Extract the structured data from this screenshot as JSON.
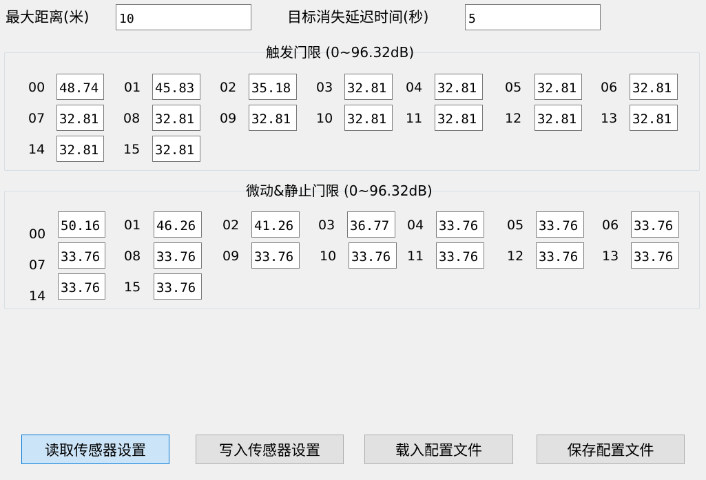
{
  "settings": {
    "max_distance_label": "最大距离(米)",
    "max_distance_value": "10",
    "delay_label": "目标消失延迟时间(秒)",
    "delay_value": "5"
  },
  "trigger_group": {
    "title": "触发门限 (0~96.32dB)",
    "gates": [
      {
        "label": "00",
        "value": "48.74"
      },
      {
        "label": "01",
        "value": "45.83"
      },
      {
        "label": "02",
        "value": "35.18"
      },
      {
        "label": "03",
        "value": "32.81"
      },
      {
        "label": "04",
        "value": "32.81"
      },
      {
        "label": "05",
        "value": "32.81"
      },
      {
        "label": "06",
        "value": "32.81"
      },
      {
        "label": "07",
        "value": "32.81"
      },
      {
        "label": "08",
        "value": "32.81"
      },
      {
        "label": "09",
        "value": "32.81"
      },
      {
        "label": "10",
        "value": "32.81"
      },
      {
        "label": "11",
        "value": "32.81"
      },
      {
        "label": "12",
        "value": "32.81"
      },
      {
        "label": "13",
        "value": "32.81"
      },
      {
        "label": "14",
        "value": "32.81"
      },
      {
        "label": "15",
        "value": "32.81"
      }
    ]
  },
  "static_group": {
    "title": "微动&静止门限 (0~96.32dB)",
    "gates": [
      {
        "label": "00",
        "value": "50.16"
      },
      {
        "label": "01",
        "value": "46.26"
      },
      {
        "label": "02",
        "value": "41.26"
      },
      {
        "label": "03",
        "value": "36.77"
      },
      {
        "label": "04",
        "value": "33.76"
      },
      {
        "label": "05",
        "value": "33.76"
      },
      {
        "label": "06",
        "value": "33.76"
      },
      {
        "label": "07",
        "value": "33.76"
      },
      {
        "label": "08",
        "value": "33.76"
      },
      {
        "label": "09",
        "value": "33.76"
      },
      {
        "label": "10",
        "value": "33.76"
      },
      {
        "label": "11",
        "value": "33.76"
      },
      {
        "label": "12",
        "value": "33.76"
      },
      {
        "label": "13",
        "value": "33.76"
      },
      {
        "label": "14",
        "value": "33.76"
      },
      {
        "label": "15",
        "value": "33.76"
      }
    ]
  },
  "buttons": {
    "read": "读取传感器设置",
    "write": "写入传感器设置",
    "load": "载入配置文件",
    "save": "保存配置文件"
  },
  "colors": {
    "window_bg": "#f0f0f0",
    "primary_button_bg": "#cce4f7",
    "primary_button_border": "#0078d7",
    "button_bg": "#e1e1e1"
  }
}
